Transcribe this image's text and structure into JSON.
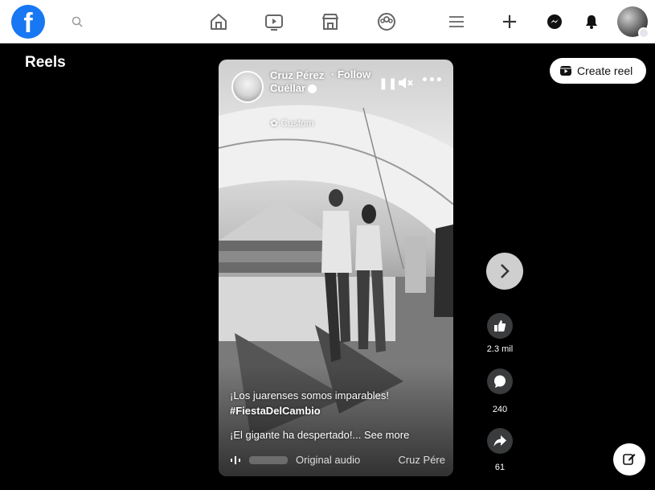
{
  "topbar": {
    "logo": "f",
    "icons": [
      "search-icon",
      "home-icon",
      "video-icon",
      "marketplace-icon",
      "groups-icon",
      "menu-icon",
      "create-icon",
      "messenger-icon",
      "bell-icon"
    ]
  },
  "reels": {
    "title": "Reels",
    "create_label": "Create reel"
  },
  "video": {
    "owner_name": "Cruz Pérez Cuéllar",
    "follow_label": "· Follow",
    "privacy_label": "✿ Custom",
    "caption_line1": "¡Los juarenses somos imparables!",
    "hashtag": "#FiestaDelCambio",
    "caption_line2": "¡El gigante ha despertado!... See more",
    "audio_label": "Original audio",
    "audio_creator": "Cruz Pére"
  },
  "actions": {
    "likes": "2.3 mil",
    "comments": "240",
    "shares": "61"
  },
  "colors": {
    "brand": "#1877f2",
    "background": "#000000",
    "action_bg": "#3a3b3c"
  }
}
